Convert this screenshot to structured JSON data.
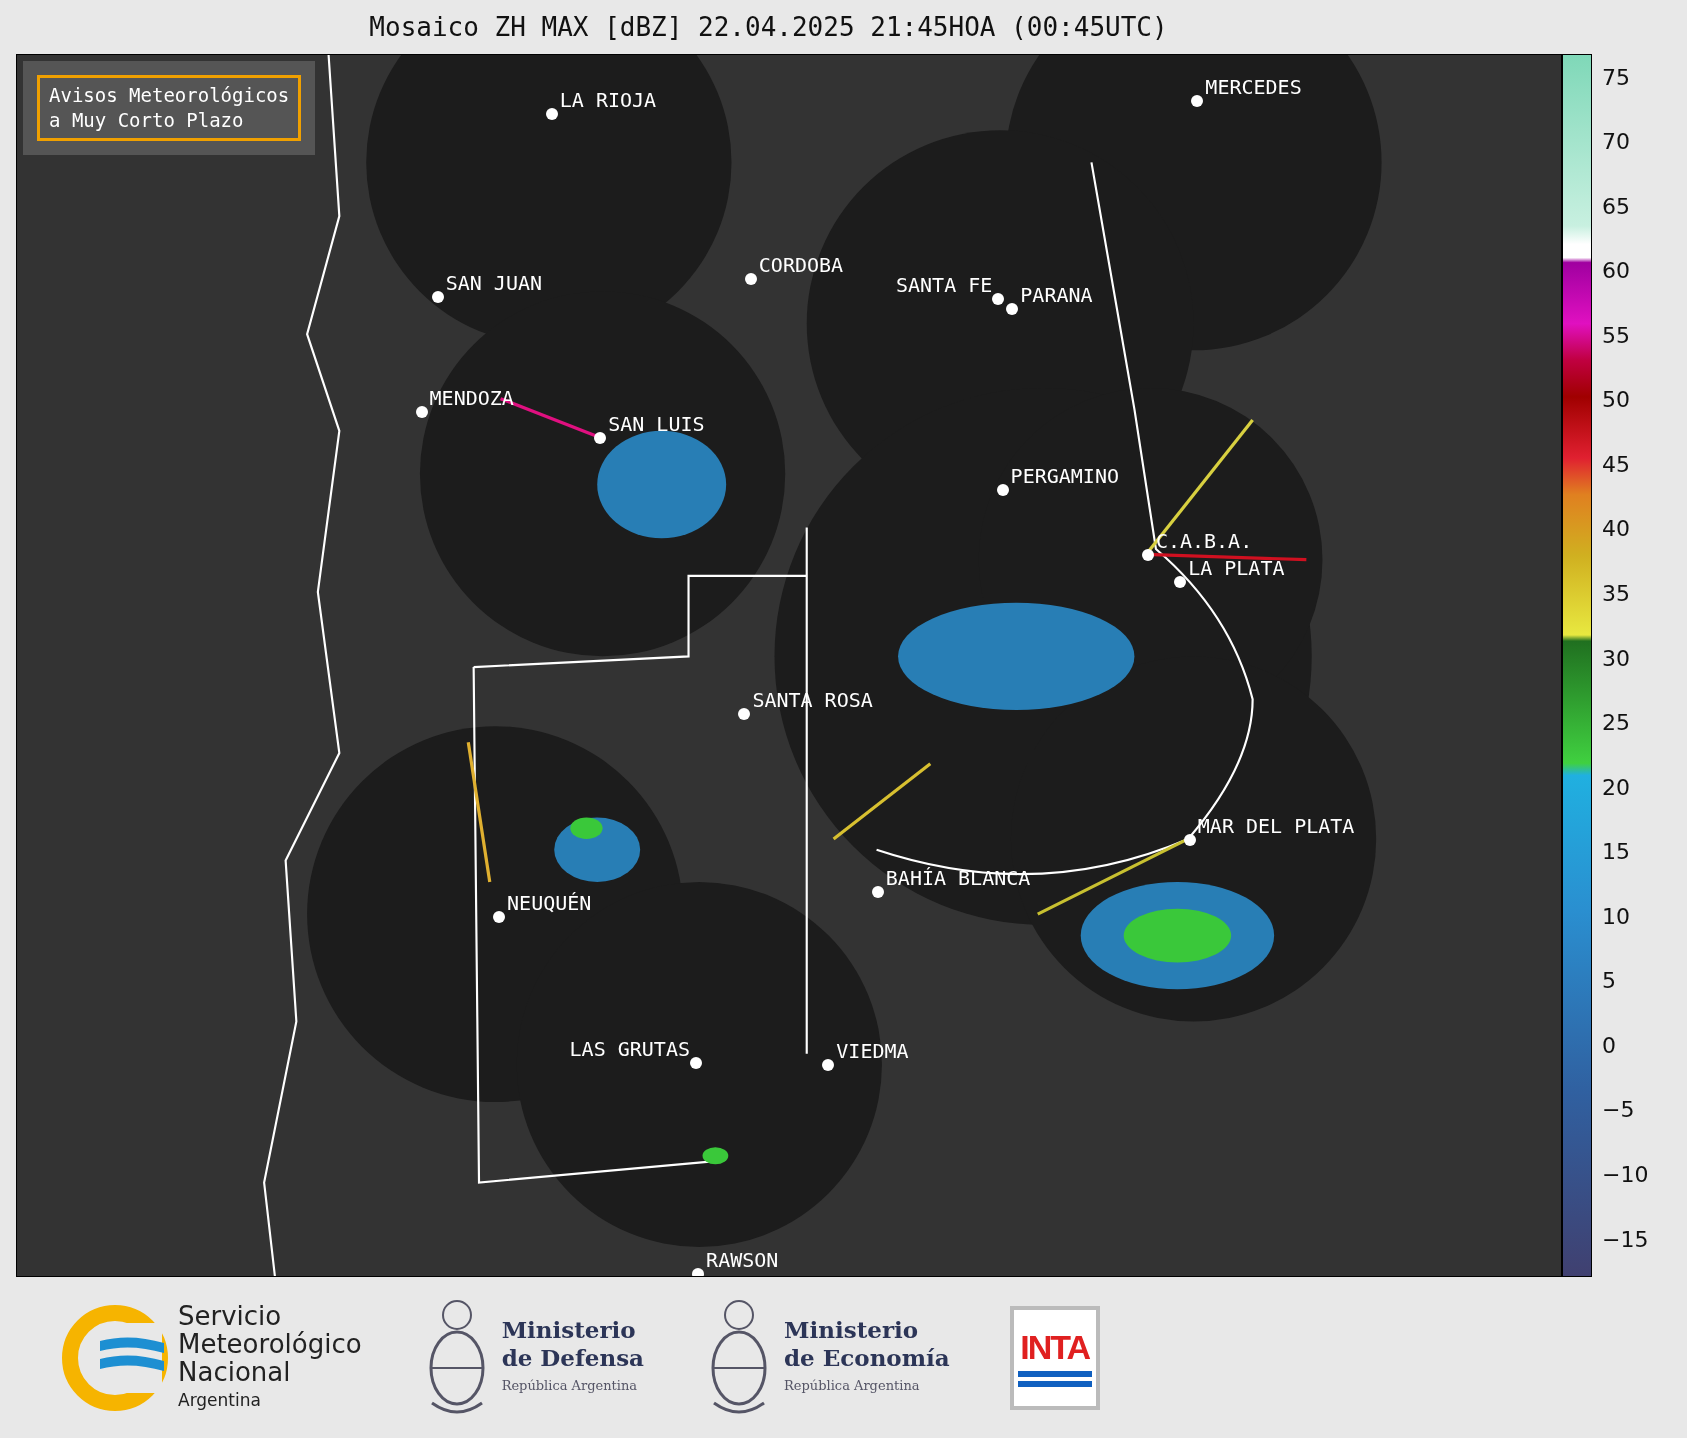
{
  "title": "Mosaico ZH MAX [dBZ] 22.04.2025 21:45HOA (00:45UTC)",
  "warning_box": {
    "lines": [
      "Avisos Meteorológicos",
      "a Muy Corto Plazo"
    ]
  },
  "cities": [
    {
      "name": "LA RIOJA"
    },
    {
      "name": "MERCEDES"
    },
    {
      "name": "CORDOBA"
    },
    {
      "name": "SAN JUAN"
    },
    {
      "name": "SANTA FE"
    },
    {
      "name": "PARANA"
    },
    {
      "name": "MENDOZA"
    },
    {
      "name": "SAN LUIS"
    },
    {
      "name": "PERGAMINO"
    },
    {
      "name": "C.A.B.A."
    },
    {
      "name": "LA PLATA"
    },
    {
      "name": "SANTA ROSA"
    },
    {
      "name": "MAR DEL PLATA"
    },
    {
      "name": "BAHÍA BLANCA"
    },
    {
      "name": "NEUQUÉN"
    },
    {
      "name": "LAS GRUTAS"
    },
    {
      "name": "VIEDMA"
    },
    {
      "name": "RAWSON"
    }
  ],
  "colorbar": {
    "ticks": [
      "75",
      "70",
      "65",
      "60",
      "55",
      "50",
      "45",
      "40",
      "35",
      "30",
      "25",
      "20",
      "15",
      "10",
      "5",
      "0",
      "−5",
      "−10",
      "−15"
    ]
  },
  "logos": {
    "smn": {
      "lines": [
        "Servicio",
        "Meteorológico",
        "Nacional"
      ],
      "country": "Argentina"
    },
    "defensa": {
      "lines": [
        "Ministerio",
        "de Defensa"
      ],
      "country": "República Argentina"
    },
    "economia": {
      "lines": [
        "Ministerio",
        "de Economía"
      ],
      "country": "República Argentina"
    },
    "inta": {
      "text": "INTA"
    }
  }
}
